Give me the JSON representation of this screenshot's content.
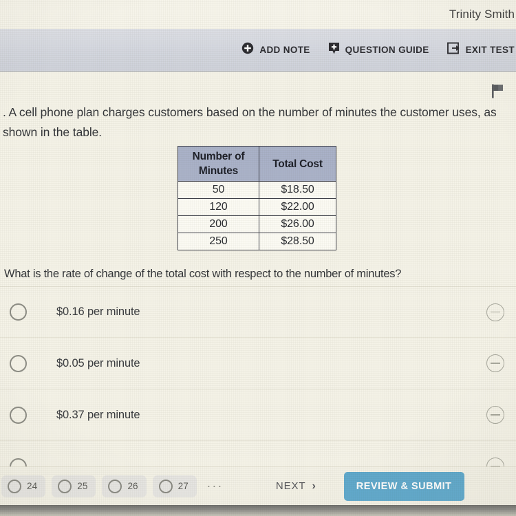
{
  "header": {
    "username": "Trinity Smith"
  },
  "toolbar": {
    "items": [
      {
        "label": "ADD NOTE",
        "icon": "plus-circle-icon"
      },
      {
        "label": "QUESTION GUIDE",
        "icon": "bookmark-plus-icon"
      },
      {
        "label": "EXIT TEST",
        "icon": "exit-arrow-icon"
      }
    ]
  },
  "question": {
    "flag_icon": "flag-icon",
    "stem": ". A cell phone plan charges customers based on the number of minutes the customer uses, as shown in the table.",
    "prompt": "What is the rate of change of the total cost with respect to the number of minutes?"
  },
  "table": {
    "headers": [
      "Number of Minutes",
      "Total Cost"
    ],
    "header_line1": "Number of",
    "header_line2": "Minutes",
    "header_cost": "Total Cost",
    "rows": [
      {
        "minutes": "50",
        "cost": "$18.50"
      },
      {
        "minutes": "120",
        "cost": "$22.00"
      },
      {
        "minutes": "200",
        "cost": "$26.00"
      },
      {
        "minutes": "250",
        "cost": "$28.50"
      }
    ]
  },
  "options": [
    {
      "label": "$0.16 per minute",
      "selected": false
    },
    {
      "label": "$0.05 per minute",
      "selected": false
    },
    {
      "label": "$0.37 per minute",
      "selected": false
    }
  ],
  "bottom_nav": {
    "questions": [
      {
        "number": "24"
      },
      {
        "number": "25"
      },
      {
        "number": "26"
      },
      {
        "number": "27"
      }
    ],
    "ellipsis": "...",
    "next_label": "NEXT",
    "next_chevron": "›",
    "submit_label": "REVIEW & SUBMIT"
  },
  "colors": {
    "page_background": "#f4f2e7",
    "toolbar_background": "#d3d6de",
    "table_header": "#aab2c8",
    "submit_button": "#60a9cc",
    "text": "#35373a"
  }
}
